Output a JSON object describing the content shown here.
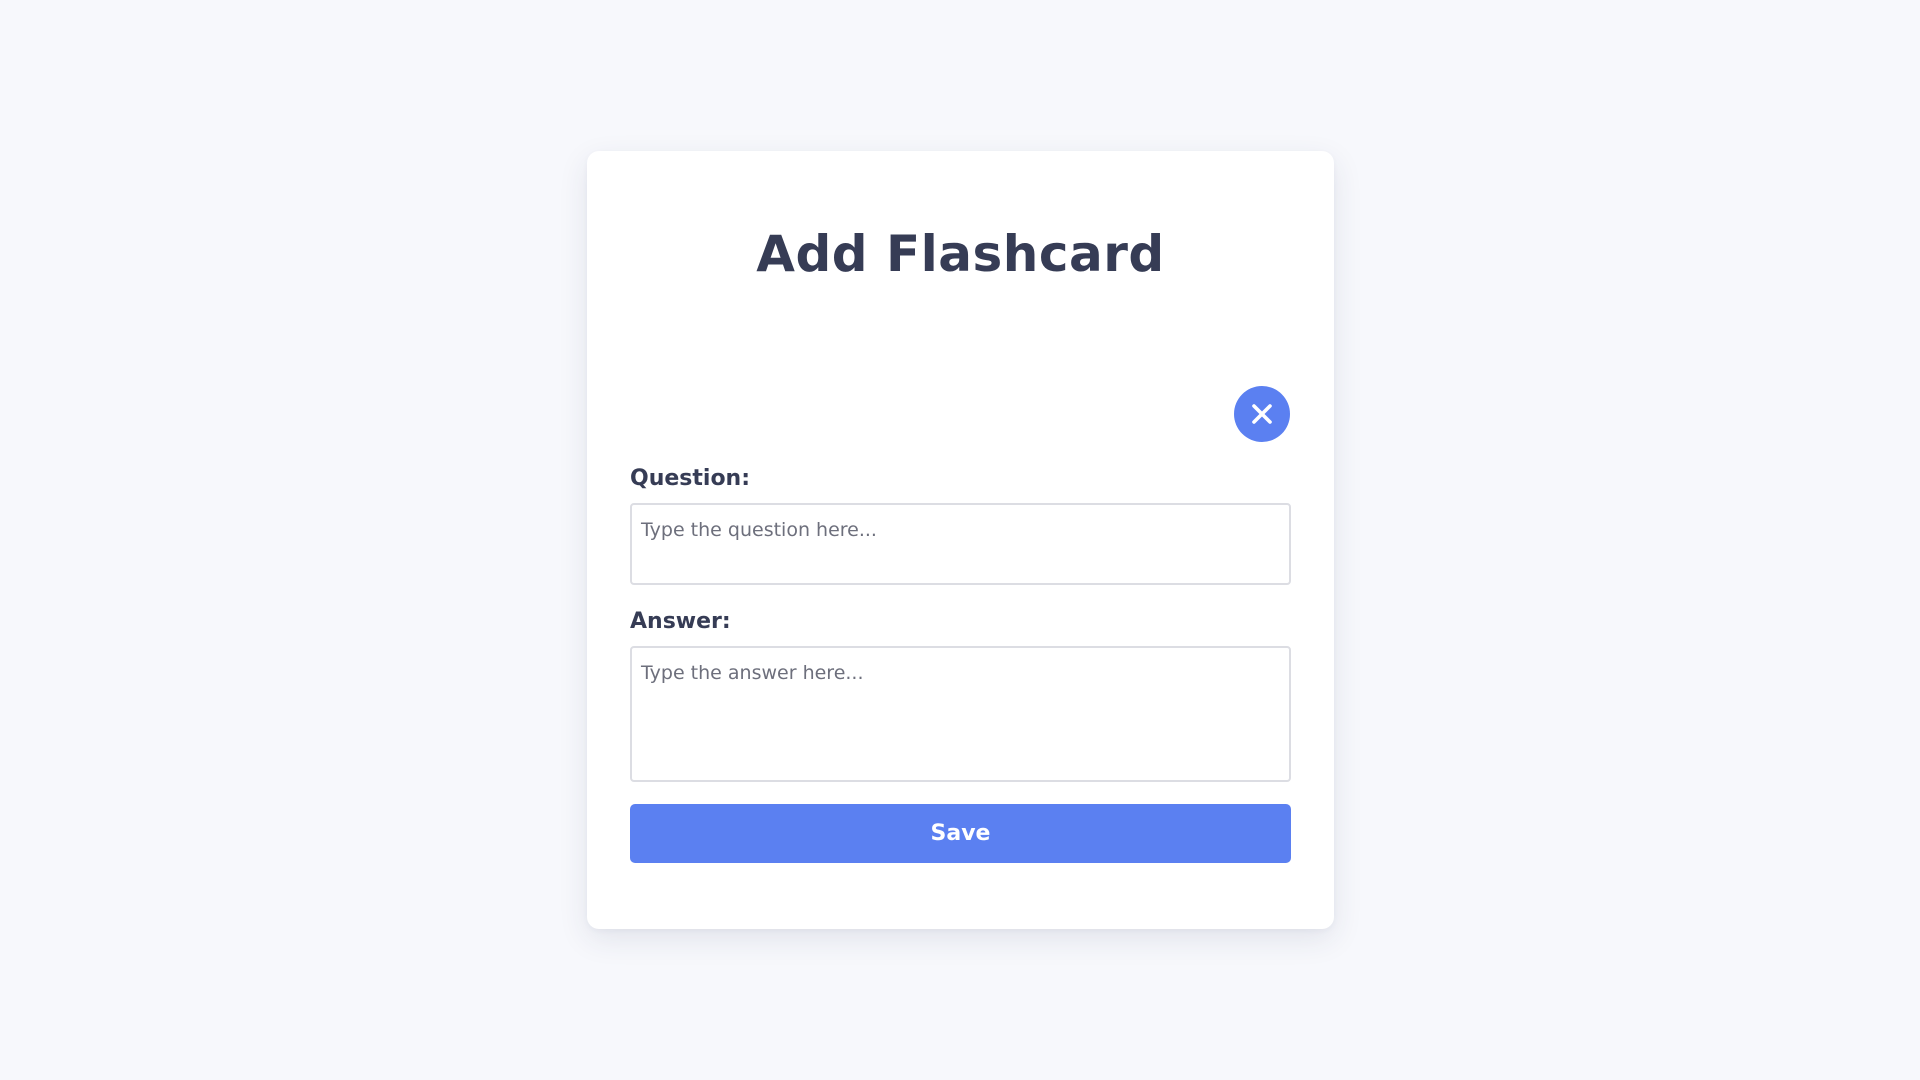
{
  "dialog": {
    "title": "Add Flashcard",
    "close_icon": "close-icon",
    "question": {
      "label": "Question:",
      "placeholder": "Type the question here...",
      "value": ""
    },
    "answer": {
      "label": "Answer:",
      "placeholder": "Type the answer here...",
      "value": ""
    },
    "save_label": "Save"
  },
  "colors": {
    "accent": "#5b80f1",
    "title_text": "#363c55",
    "background": "#f7f8fc",
    "card": "#ffffff",
    "input_border": "#dcdde3",
    "placeholder_text": "#6d6f7c"
  }
}
